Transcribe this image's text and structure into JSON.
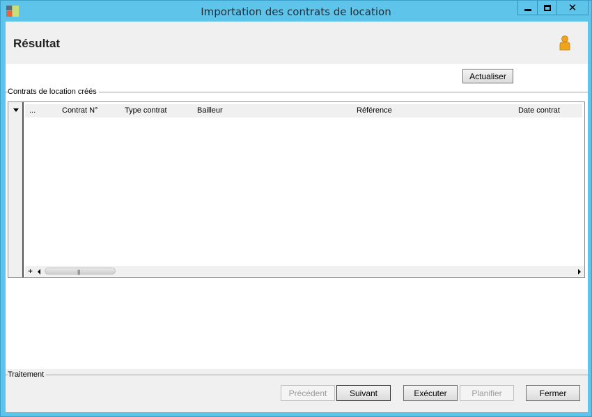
{
  "window": {
    "title": "Importation des contrats de location",
    "minimize": "minimize",
    "maximize": "maximize",
    "close": "✕"
  },
  "header": {
    "title": "Résultat"
  },
  "toolbar": {
    "refresh_label": "Actualiser"
  },
  "contracts_group": {
    "label": "Contrats de location créés",
    "columns": [
      "...",
      "Contrat N°",
      "Type contrat",
      "Bailleur",
      "Référence",
      "Date contrat"
    ],
    "rows": []
  },
  "processing_group": {
    "label": "Traitement"
  },
  "footer_buttons": {
    "previous": "Précédent",
    "next": "Suivant",
    "execute": "Exécuter",
    "schedule": "Planifier",
    "close": "Fermer"
  },
  "icons": {
    "app": "app-grid-icon",
    "user": "user-icon",
    "sort": "dropdown-arrow-icon",
    "add": "plus-icon"
  },
  "colors": {
    "title_bar": "#5fc4ea",
    "header_bg": "#f0f0f0",
    "user_icon": "#f0a31e"
  }
}
